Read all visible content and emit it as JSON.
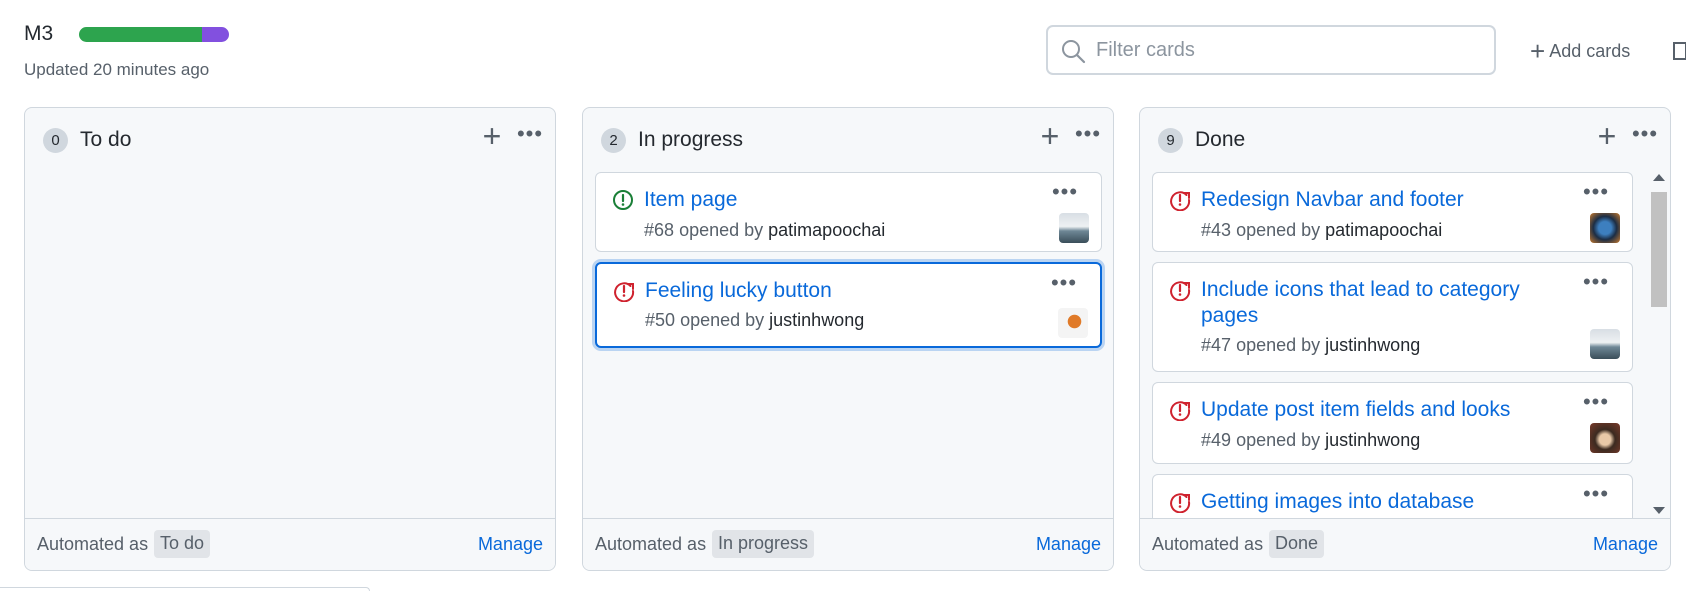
{
  "project": {
    "title": "M3",
    "updated": "Updated 20 minutes ago",
    "progress": {
      "done_fraction": 0.82,
      "in_progress_fraction": 0.18,
      "done_color": "#2da44e",
      "in_progress_color": "#8250df"
    }
  },
  "toolbar": {
    "filter_placeholder": "Filter cards",
    "add_cards_label": "Add cards"
  },
  "columns": [
    {
      "name": "To do",
      "count": "0",
      "automated_label": "Automated as",
      "automated_value": "To do",
      "manage_label": "Manage",
      "cards": []
    },
    {
      "name": "In progress",
      "count": "2",
      "automated_label": "Automated as",
      "automated_value": "In progress",
      "manage_label": "Manage",
      "cards": [
        {
          "title": "Item page",
          "number": "#68",
          "opened_by": "opened by",
          "user": "patimapoochai",
          "state": "open",
          "state_color": "#1a7f37",
          "avatar": "landscape"
        },
        {
          "title": "Feeling lucky button",
          "number": "#50",
          "opened_by": "opened by",
          "user": "justinhwong",
          "state": "closed-not-planned",
          "state_color": "#cf222e",
          "avatar": "figure",
          "selected": true
        }
      ]
    },
    {
      "name": "Done",
      "count": "9",
      "automated_label": "Automated as",
      "automated_value": "Done",
      "manage_label": "Manage",
      "cards": [
        {
          "title": "Redesign Navbar and footer",
          "number": "#43",
          "opened_by": "opened by",
          "user": "patimapoochai",
          "state": "closed-not-planned",
          "state_color": "#cf222e",
          "avatar": "night"
        },
        {
          "title": "Include icons that lead to category pages",
          "number": "#47",
          "opened_by": "opened by",
          "user": "justinhwong",
          "state": "closed-not-planned",
          "state_color": "#cf222e",
          "avatar": "landscape"
        },
        {
          "title": "Update post item fields and looks",
          "number": "#49",
          "opened_by": "opened by",
          "user": "justinhwong",
          "state": "closed-not-planned",
          "state_color": "#cf222e",
          "avatar": "portrait"
        },
        {
          "title": "Getting images into database",
          "state": "closed-not-planned",
          "state_color": "#cf222e"
        }
      ]
    }
  ]
}
